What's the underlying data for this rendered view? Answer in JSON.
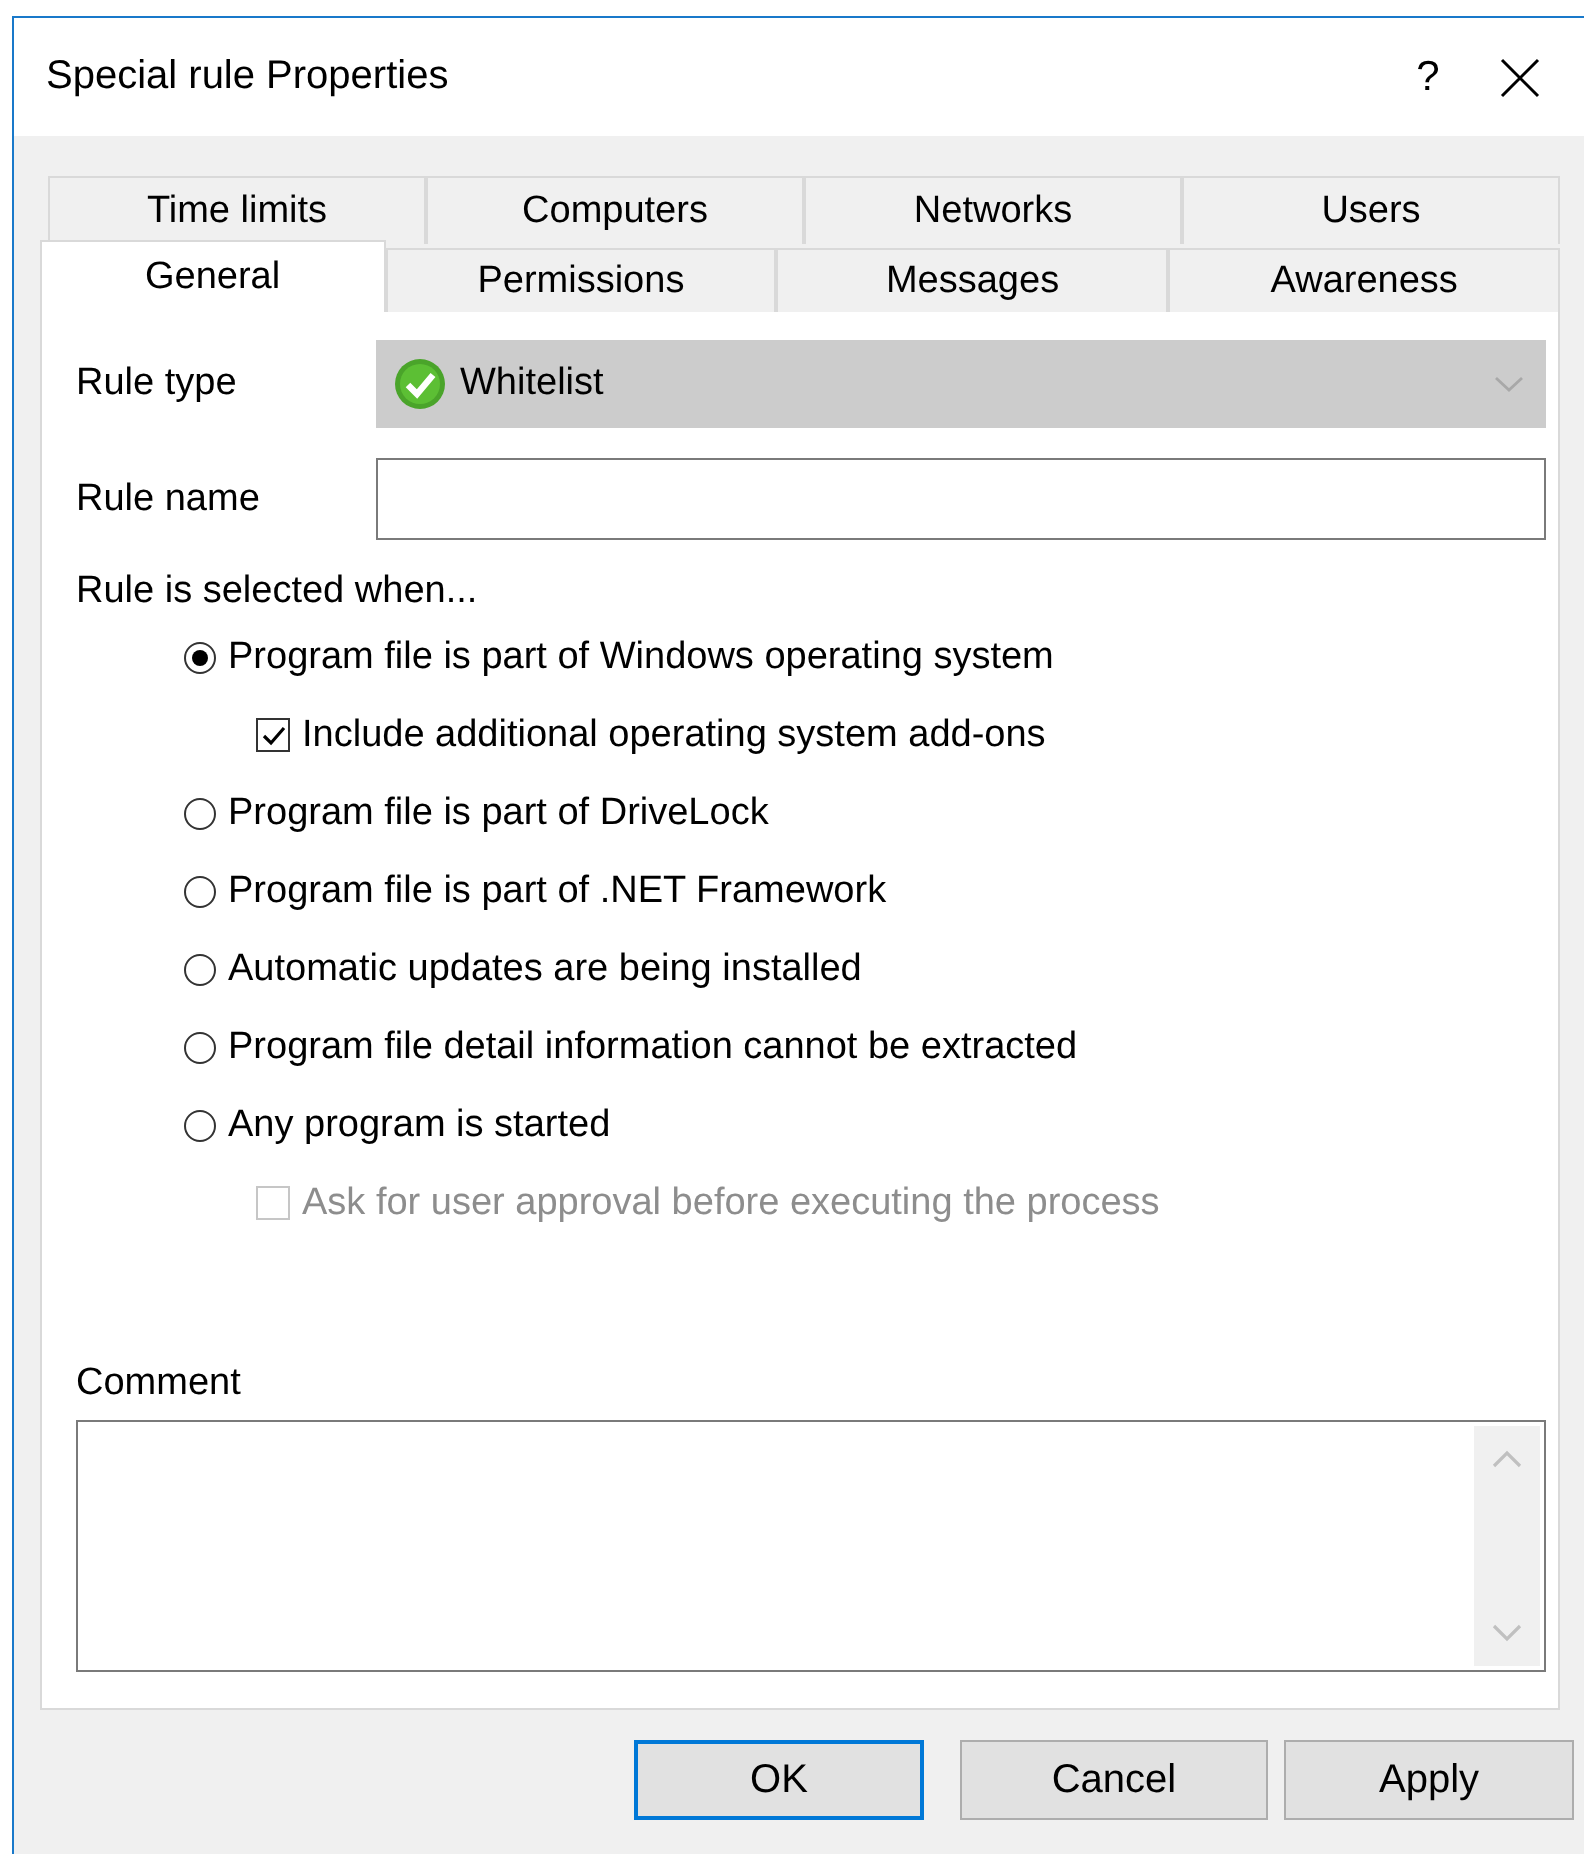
{
  "window": {
    "title": "Special rule Properties",
    "help": "?"
  },
  "tabs": [
    [
      {
        "label": "Time limits",
        "selected": false
      },
      {
        "label": "Computers",
        "selected": false
      },
      {
        "label": "Networks",
        "selected": false
      },
      {
        "label": "Users",
        "selected": false
      }
    ],
    [
      {
        "label": "General",
        "selected": true
      },
      {
        "label": "Permissions",
        "selected": false
      },
      {
        "label": "Messages",
        "selected": false
      },
      {
        "label": "Awareness",
        "selected": false
      }
    ]
  ],
  "rule_type": {
    "label": "Rule type",
    "value": "Whitelist",
    "disabled": true
  },
  "rule_name": {
    "label": "Rule name"
  },
  "selection_heading": "Rule is selected when...",
  "options": [
    {
      "kind": "radio",
      "label": "Program file is part of Windows operating system",
      "selected": true,
      "children": [
        {
          "kind": "checkbox",
          "label": "Include additional operating system add-ons",
          "checked": true,
          "disabled": false
        }
      ]
    },
    {
      "kind": "radio",
      "label": "Program file is part of DriveLock",
      "selected": false
    },
    {
      "kind": "radio",
      "label": "Program file is part of .NET Framework",
      "selected": false
    },
    {
      "kind": "radio",
      "label": "Automatic updates are being installed",
      "selected": false
    },
    {
      "kind": "radio",
      "label": "Program file detail information cannot be extracted",
      "selected": false
    },
    {
      "kind": "radio",
      "label": "Any program is started",
      "selected": false,
      "children": [
        {
          "kind": "checkbox",
          "label": "Ask for user approval before executing the process",
          "checked": false,
          "disabled": true
        }
      ]
    }
  ],
  "comment": {
    "label": "Comment"
  },
  "buttons": [
    {
      "label": "OK",
      "default": true
    },
    {
      "label": "Cancel",
      "default": false
    },
    {
      "label": "Apply",
      "default": false
    }
  ]
}
